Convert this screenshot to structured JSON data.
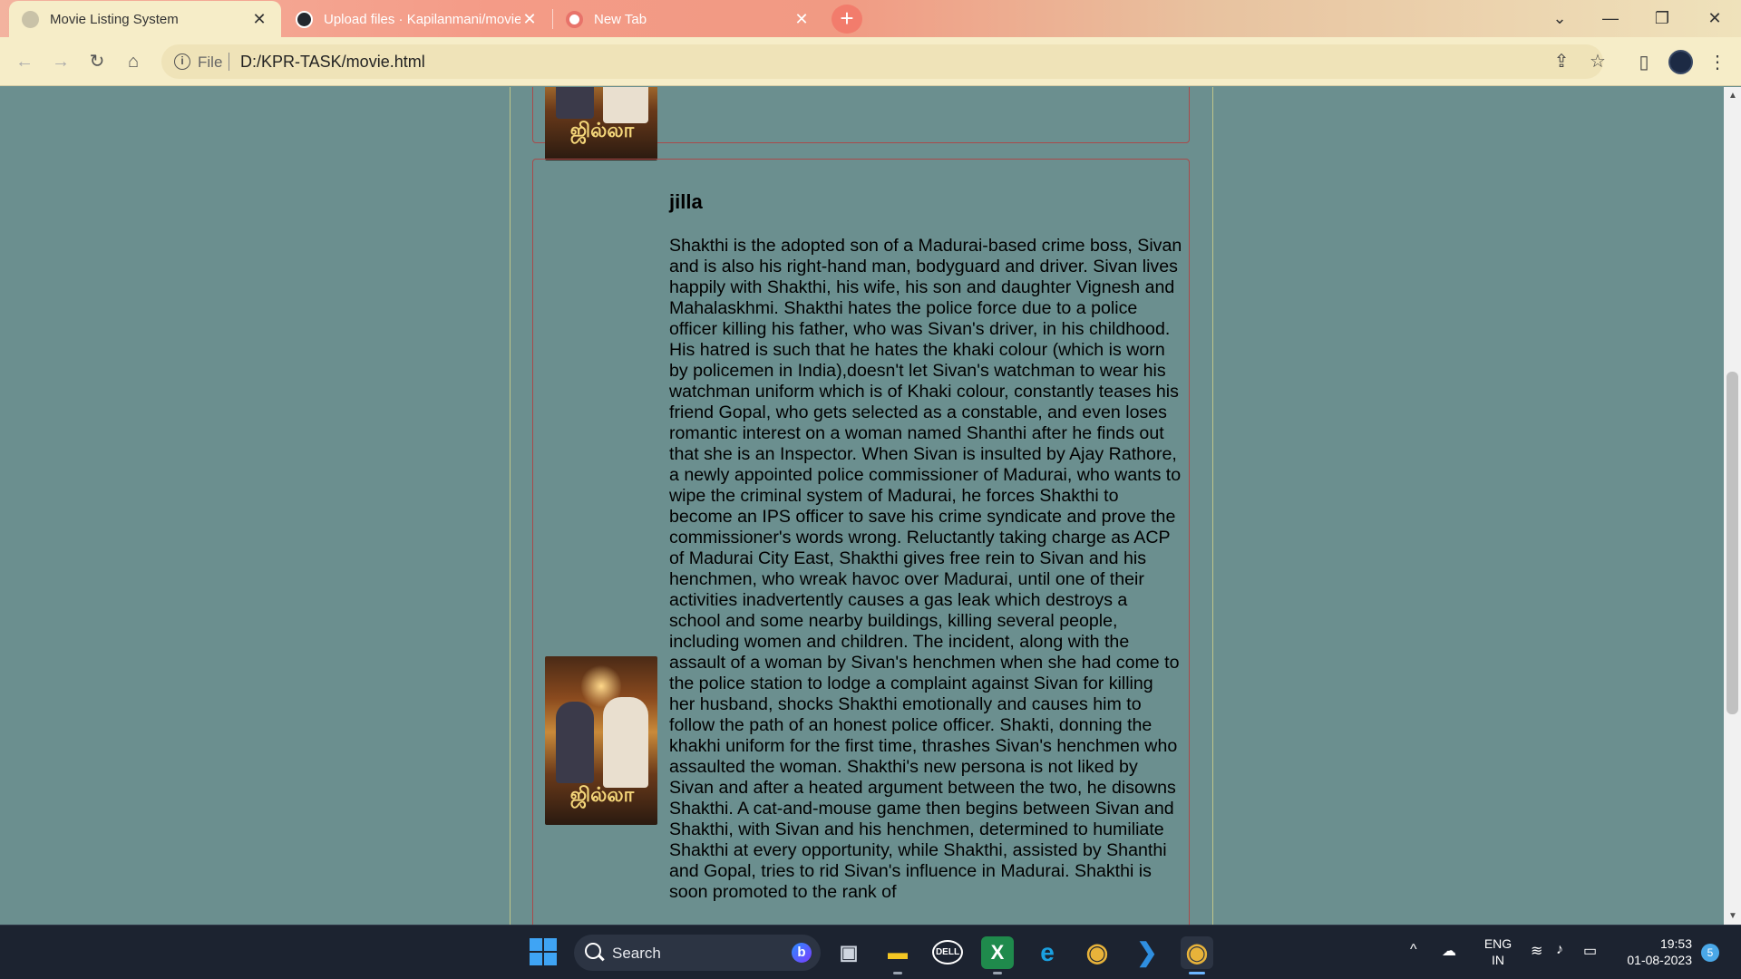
{
  "browser": {
    "tabs": [
      {
        "title": "Movie Listing System",
        "close": "✕",
        "active": true
      },
      {
        "title": "Upload files · Kapilanmani/movie",
        "close": "✕",
        "active": false
      },
      {
        "title": "New Tab",
        "close": "✕",
        "active": false
      }
    ],
    "new_tab": "+",
    "window_controls": {
      "tab_search": "⌄",
      "minimize": "—",
      "restore": "❐",
      "close": "✕"
    },
    "nav": {
      "back": "←",
      "forward": "→",
      "reload": "↻",
      "home": "⌂"
    },
    "address": {
      "info": "i",
      "scheme": "File",
      "url": "D:/KPR-TASK/movie.html"
    },
    "toolbar_icons": {
      "share": "⇪",
      "bookmark": "☆",
      "side_panel": "▯",
      "menu": "⋮"
    }
  },
  "movie": {
    "title": "jilla",
    "description": "Shakthi is the adopted son of a Madurai-based crime boss, Sivan and is also his right-hand man, bodyguard and driver. Sivan lives happily with Shakthi, his wife, his son and daughter Vignesh and Mahalaskhmi. Shakthi hates the police force due to a police officer killing his father, who was Sivan's driver, in his childhood. His hatred is such that he hates the khaki colour (which is worn by policemen in India),doesn't let Sivan's watchman to wear his watchman uniform which is of Khaki colour, constantly teases his friend Gopal, who gets selected as a constable, and even loses romantic interest on a woman named Shanthi after he finds out that she is an Inspector. When Sivan is insulted by Ajay Rathore, a newly appointed police commissioner of Madurai, who wants to wipe the criminal system of Madurai, he forces Shakthi to become an IPS officer to save his crime syndicate and prove the commissioner's words wrong. Reluctantly taking charge as ACP of Madurai City East, Shakthi gives free rein to Sivan and his henchmen, who wreak havoc over Madurai, until one of their activities inadvertently causes a gas leak which destroys a school and some nearby buildings, killing several people, including women and children. The incident, along with the assault of a woman by Sivan's henchmen when she had come to the police station to lodge a complaint against Sivan for killing her husband, shocks Shakthi emotionally and causes him to follow the path of an honest police officer. Shakti, donning the khakhi uniform for the first time, thrashes Sivan's henchmen who assaulted the woman. Shakthi's new persona is not liked by Sivan and after a heated argument between the two, he disowns Shakthi. A cat-and-mouse game then begins between Sivan and Shakthi, with Sivan and his henchmen, determined to humiliate Shakthi at every opportunity, while Shakthi, assisted by Shanthi and Gopal, tries to rid Sivan's influence in Madurai. Shakthi is soon promoted to the rank of",
    "poster_logo": "ஜில்லா"
  },
  "scrollbar": {
    "up": "▲",
    "down": "▼",
    "position": 0.36
  },
  "taskbar": {
    "search_label": "Search",
    "bing": "b",
    "apps": [
      {
        "name": "task-view",
        "glyph": "▣",
        "color": "#cfd6e0"
      },
      {
        "name": "file-explorer",
        "glyph": "▬",
        "color": "#f3c623"
      },
      {
        "name": "dell",
        "glyph": "DELL",
        "color": "#ffffff"
      },
      {
        "name": "excel",
        "glyph": "X",
        "color": "#1f8a4c"
      },
      {
        "name": "edge",
        "glyph": "e",
        "color": "#1aa0e0"
      },
      {
        "name": "chrome",
        "glyph": "◉",
        "color": "#e8b33a"
      },
      {
        "name": "vscode",
        "glyph": "❯",
        "color": "#2f8fe0"
      },
      {
        "name": "chrome-active",
        "glyph": "◉",
        "color": "#e8b33a"
      }
    ],
    "tray": {
      "chevron": "^",
      "cloud": "☁",
      "lang_top": "ENG",
      "lang_bottom": "IN",
      "wifi": "≋",
      "volume": "♪",
      "battery": "▭"
    },
    "time": "19:53",
    "date": "01-08-2023",
    "notification_count": "5"
  }
}
